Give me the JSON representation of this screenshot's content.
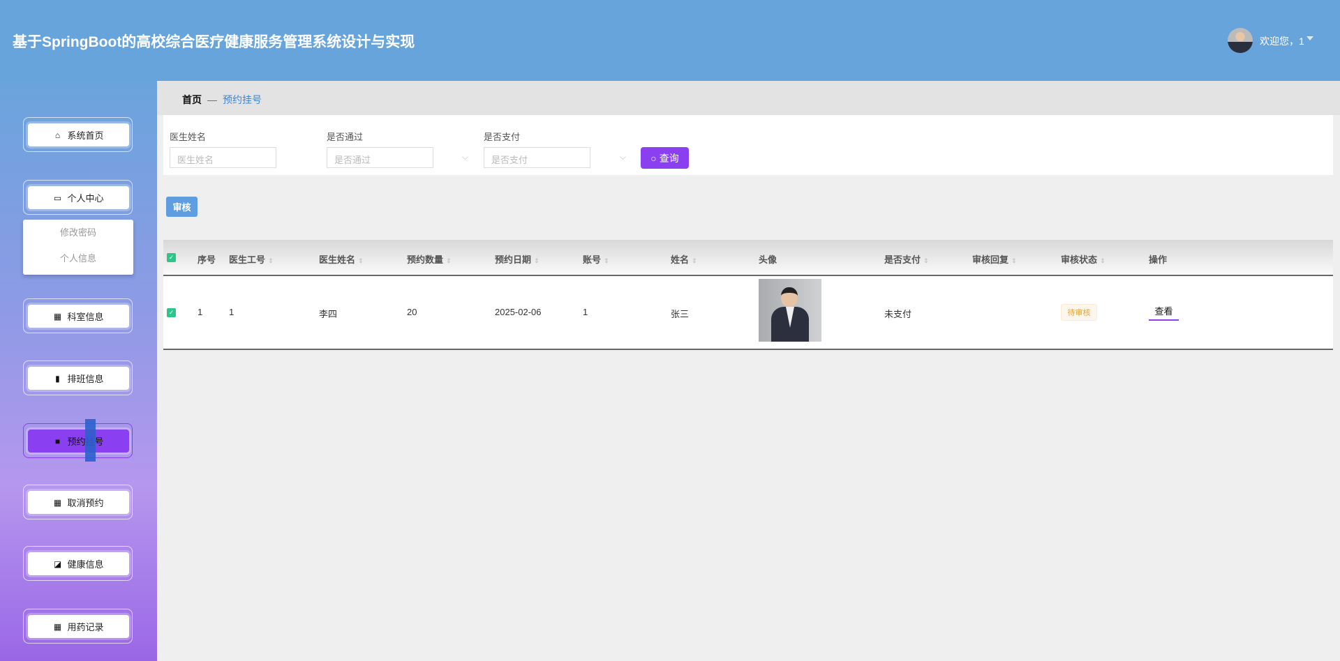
{
  "header": {
    "title": "基于SpringBoot的高校综合医疗健康服务管理系统设计与实现",
    "welcome": "欢迎您，1",
    "bg_color": "#68a4dc"
  },
  "sidebar": {
    "items": [
      {
        "label": "系统首页",
        "icon": "home-icon"
      },
      {
        "label": "个人中心",
        "icon": "wallet-icon"
      },
      {
        "label": "科室信息",
        "icon": "grid-icon"
      },
      {
        "label": "排班信息",
        "icon": "bar-chart-icon"
      },
      {
        "label": "预约挂号",
        "icon": "briefcase-icon",
        "active": true
      },
      {
        "label": "取消预约",
        "icon": "grid-icon"
      },
      {
        "label": "健康信息",
        "icon": "trend-icon"
      },
      {
        "label": "用药记录",
        "icon": "grid-icon"
      }
    ],
    "submenu": [
      "修改密码",
      "个人信息"
    ],
    "active_color": "#8a3ff0"
  },
  "breadcrumb": {
    "home": "首页",
    "separator": "—",
    "current": "预约挂号"
  },
  "search": {
    "fields": [
      {
        "label": "医生姓名",
        "placeholder": "医生姓名"
      },
      {
        "label": "是否通过",
        "placeholder": "是否通过"
      },
      {
        "label": "是否支付",
        "placeholder": "是否支付"
      }
    ],
    "button": "查询"
  },
  "toolbar": {
    "audit": "审核"
  },
  "table": {
    "headers": [
      "序号",
      "医生工号",
      "医生姓名",
      "预约数量",
      "预约日期",
      "账号",
      "姓名",
      "头像",
      "是否支付",
      "审核回复",
      "审核状态",
      "操作"
    ],
    "rows": [
      {
        "index": "1",
        "doctor_id": "1",
        "doctor_name": "李四",
        "count": "20",
        "date": "2025-02-06",
        "account": "1",
        "name": "张三",
        "paid": "未支付",
        "reply": "",
        "status": "待审核",
        "action": "查看",
        "checked": true
      }
    ]
  }
}
